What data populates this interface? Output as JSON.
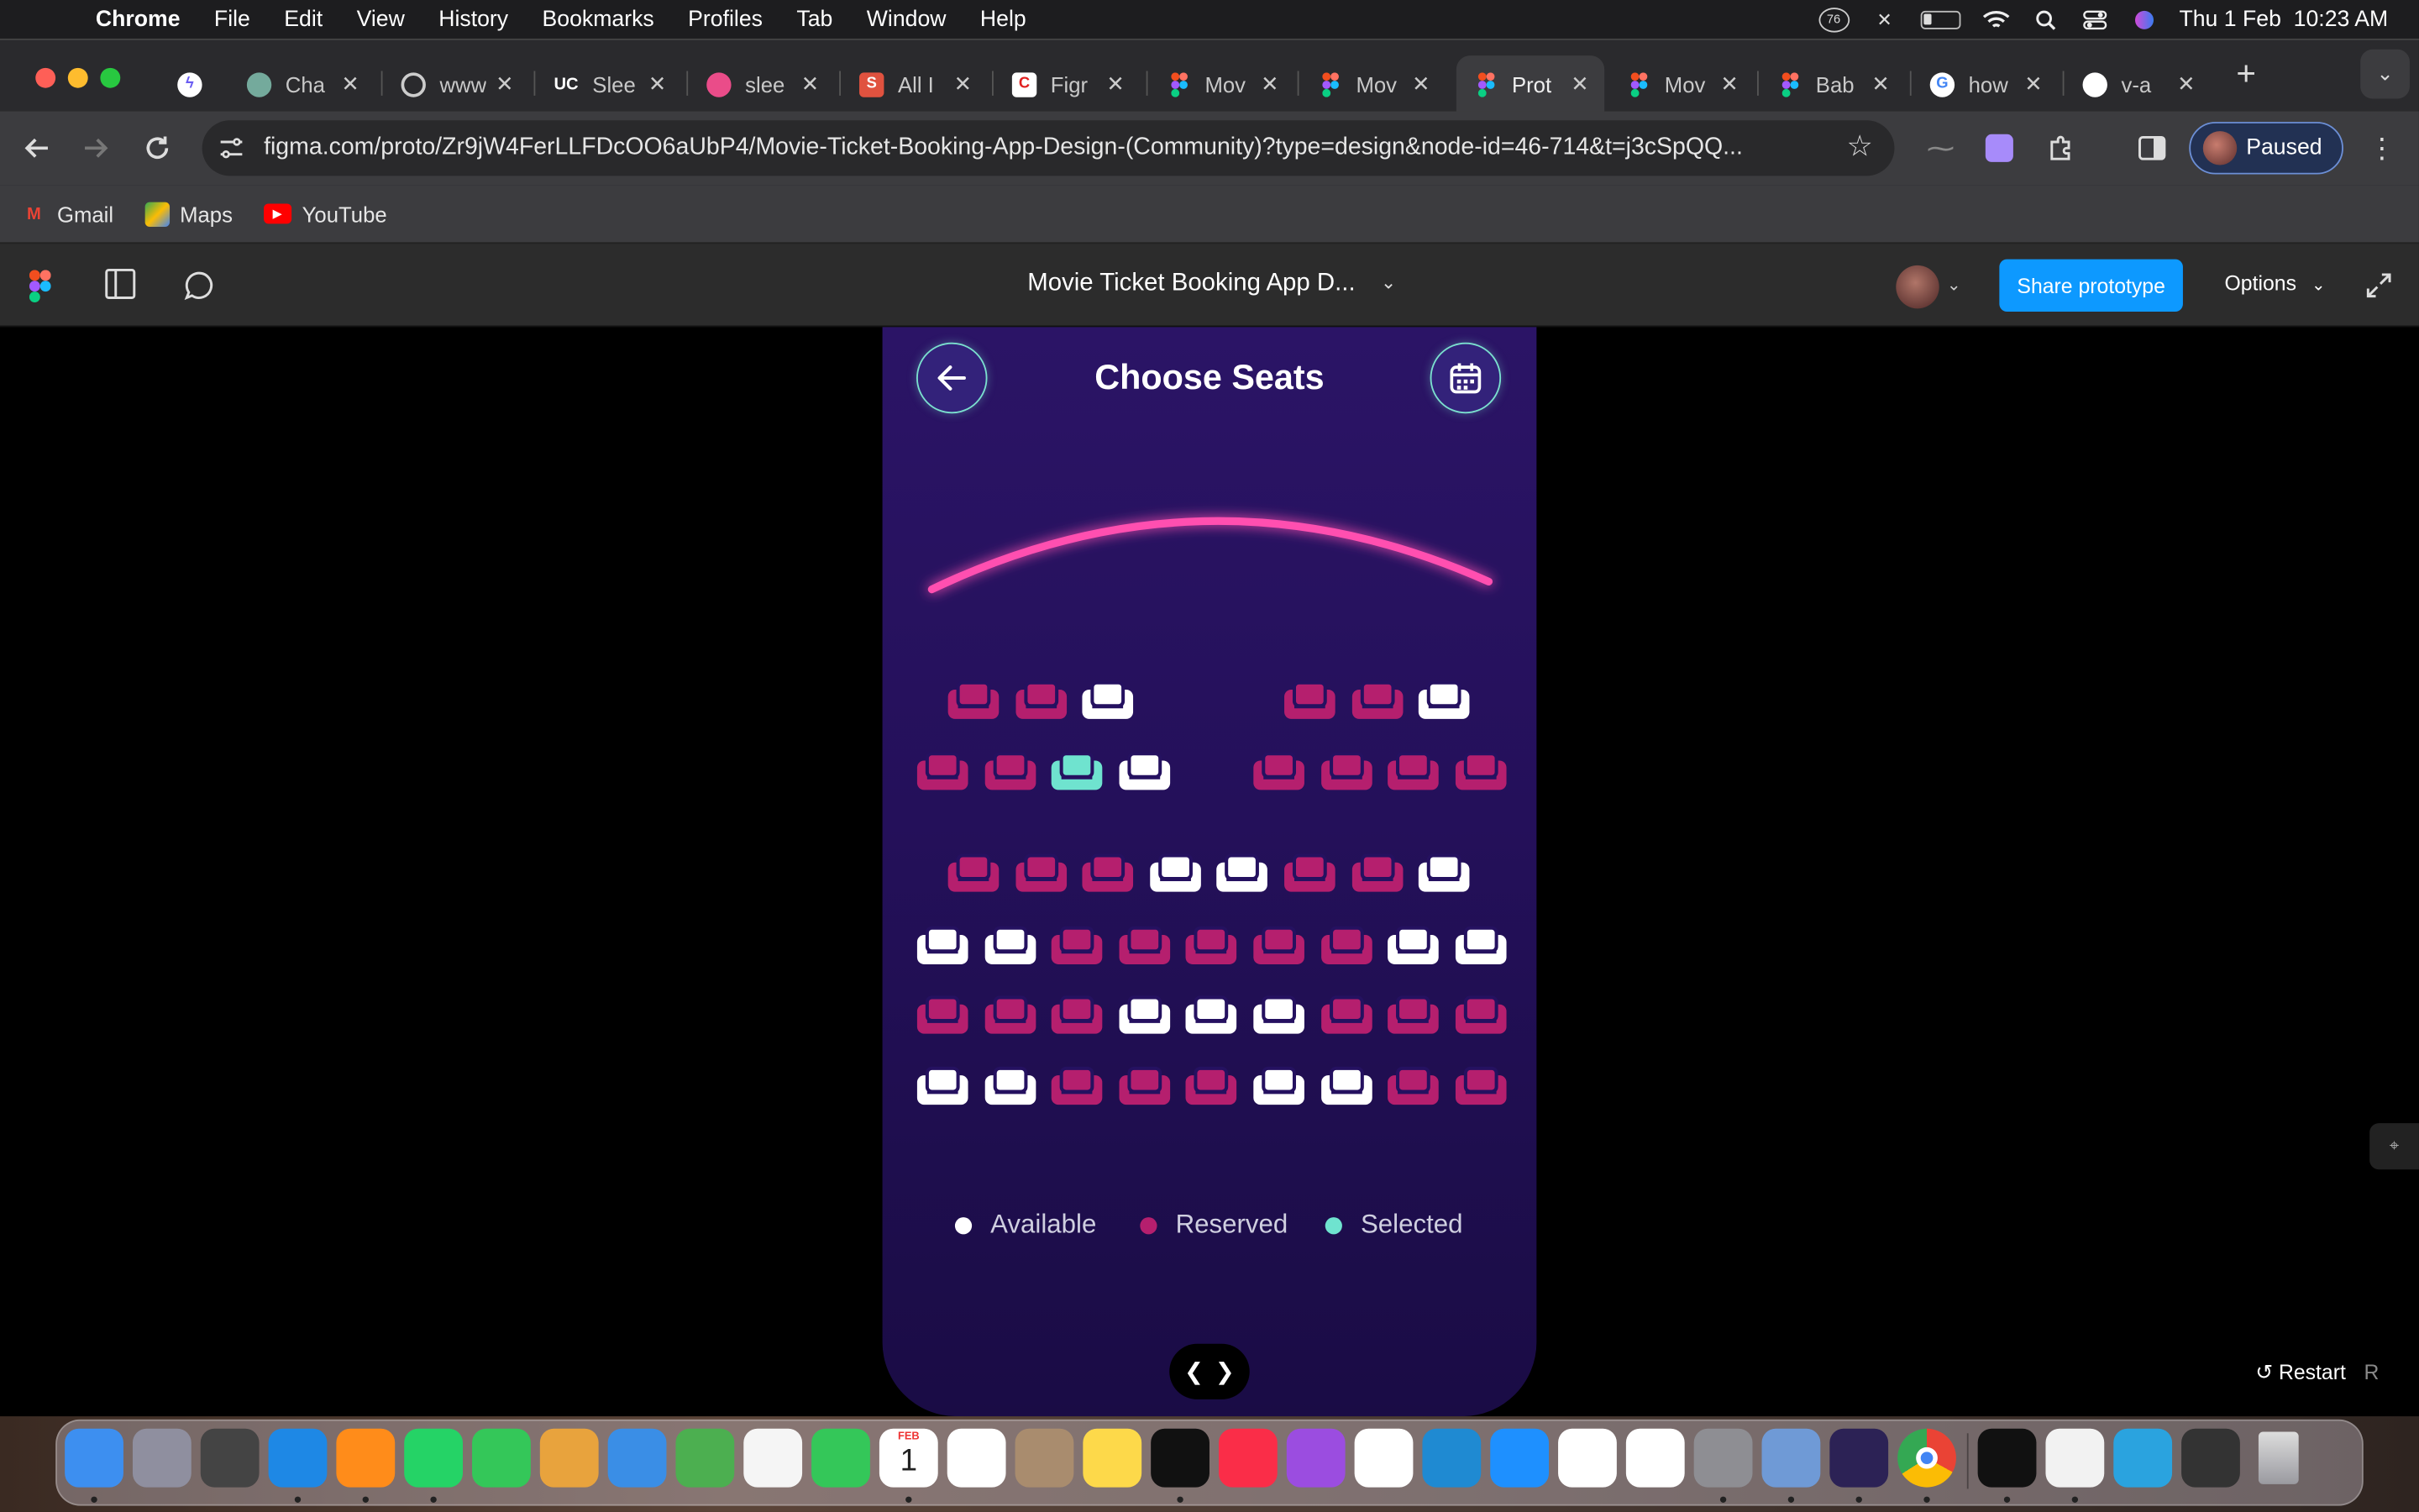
{
  "menubar": {
    "app": "Chrome",
    "items": [
      "File",
      "Edit",
      "View",
      "History",
      "Bookmarks",
      "Profiles",
      "Tab",
      "Window",
      "Help"
    ],
    "clock": "Thu 1 Feb  10:23 AM",
    "badge": "76"
  },
  "tabs": [
    {
      "title": "Cha",
      "fav": "chatgpt-icon",
      "color": "#74aa9c"
    },
    {
      "title": "www",
      "fav": "globe-icon",
      "color": "#888"
    },
    {
      "title": "Slee",
      "fav": "uc-icon",
      "color": "#2a2a2d"
    },
    {
      "title": "slee",
      "fav": "dribbble-icon",
      "color": "#ea4c89"
    },
    {
      "title": "All I",
      "fav": "s-icon",
      "color": "#e0523f"
    },
    {
      "title": "Figr",
      "fav": "c-icon",
      "color": "#e02020"
    },
    {
      "title": "Mov",
      "fav": "figma-icon",
      "color": "#a259ff"
    },
    {
      "title": "Mov",
      "fav": "figma-icon",
      "color": "#a259ff"
    },
    {
      "title": "Prot",
      "fav": "figma-icon",
      "color": "#a259ff"
    },
    {
      "title": "Mov",
      "fav": "figma-icon",
      "color": "#a259ff"
    },
    {
      "title": "Bab",
      "fav": "figma-icon",
      "color": "#a259ff"
    },
    {
      "title": "how",
      "fav": "google-icon",
      "color": "#4285f4"
    },
    {
      "title": "v-a",
      "fav": "github-icon",
      "color": "#fff"
    }
  ],
  "omnibox": {
    "url": "figma.com/proto/Zr9jW4FerLLFDcOO6aUbP4/Movie-Ticket-Booking-App-Design-(Community)?type=design&node-id=46-714&t=j3cSpQQ..."
  },
  "profile": {
    "label": "Paused"
  },
  "bookmarks": [
    {
      "label": "Gmail",
      "color": "#ea4335"
    },
    {
      "label": "Maps",
      "color": "#34a853"
    },
    {
      "label": "YouTube",
      "color": "#ff0000"
    }
  ],
  "figma": {
    "file_title": "Movie Ticket Booking App D...",
    "share_label": "Share prototype",
    "options_label": "Options",
    "restart_label": "Restart",
    "restart_key": "R"
  },
  "app": {
    "title": "Choose Seats",
    "legend": [
      {
        "label": "Available",
        "color": "#ffffff"
      },
      {
        "label": "Reserved",
        "color": "#b51f6e"
      },
      {
        "label": "Selected",
        "color": "#6fe3cf"
      }
    ],
    "seat_colors": {
      "available": "#ffffff",
      "reserved": "#b51f6e",
      "selected": "#6fe3cf"
    },
    "screen_color": "#ff4fb0",
    "seat_rows": [
      [
        "R",
        "R",
        "A",
        "_",
        "_",
        "R",
        "R",
        "A"
      ],
      [
        "R",
        "R",
        "S",
        "A",
        "_",
        "R",
        "R",
        "R",
        "R"
      ],
      [
        "R",
        "R",
        "R",
        "A",
        "A",
        "R",
        "R",
        "A"
      ],
      [
        "A",
        "A",
        "R",
        "R",
        "R",
        "R",
        "R",
        "A",
        "A"
      ],
      [
        "R",
        "R",
        "R",
        "A",
        "A",
        "A",
        "R",
        "R",
        "R"
      ],
      [
        "A",
        "A",
        "R",
        "R",
        "R",
        "A",
        "A",
        "R",
        "R"
      ]
    ]
  },
  "dock": [
    "finder",
    "launchpad",
    "keychain",
    "safari",
    "books",
    "whatsapp",
    "messages",
    "preview",
    "mail",
    "maps",
    "photos",
    "facetime",
    "calendar",
    "reminders",
    "contacts",
    "notes",
    "appletv",
    "music",
    "podcasts",
    "numbers",
    "vscode",
    "appstore",
    "keynote",
    "pages",
    "settings",
    "preview2",
    "eclipse",
    "chrome",
    "terminal",
    "textedit",
    "telegram",
    "sublime",
    "trash"
  ],
  "calendar_icon": {
    "month": "FEB",
    "day": "1"
  }
}
